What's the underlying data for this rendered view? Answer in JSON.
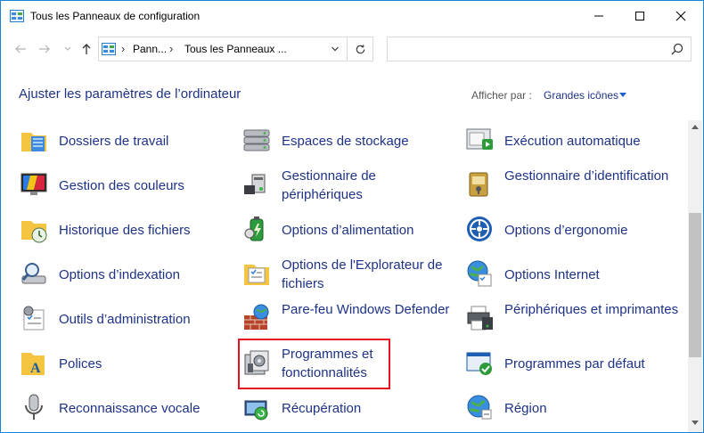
{
  "window": {
    "title": "Tous les Panneaux de configuration",
    "controls": [
      "minimize",
      "maximize",
      "close"
    ]
  },
  "address": {
    "crumb1": "Pann...",
    "crumb2": "Tous les Panneaux ...",
    "search_placeholder": ""
  },
  "header": {
    "title": "Ajuster les paramètres de l’ordinateur",
    "view_label": "Afficher par :",
    "view_value": "Grandes icônes"
  },
  "items": [
    {
      "label": "Dossiers de travail",
      "icon": "work-folders-icon"
    },
    {
      "label": "Espaces de stockage",
      "icon": "storage-spaces-icon"
    },
    {
      "label": "Exécution automatique",
      "icon": "autoplay-icon"
    },
    {
      "label": "Gestion des couleurs",
      "icon": "color-management-icon"
    },
    {
      "label": "Gestionnaire de périphériques",
      "icon": "device-manager-icon"
    },
    {
      "label": "Gestionnaire d’identification",
      "icon": "credential-manager-icon"
    },
    {
      "label": "Historique des fichiers",
      "icon": "file-history-icon"
    },
    {
      "label": "Options d’alimentation",
      "icon": "power-options-icon"
    },
    {
      "label": "Options d’ergonomie",
      "icon": "ease-of-access-icon"
    },
    {
      "label": "Options d’indexation",
      "icon": "indexing-options-icon"
    },
    {
      "label": "Options de l'Explorateur de fichiers",
      "icon": "explorer-options-icon"
    },
    {
      "label": "Options Internet",
      "icon": "internet-options-icon"
    },
    {
      "label": "Outils d’administration",
      "icon": "admin-tools-icon"
    },
    {
      "label": "Pare-feu Windows Defender",
      "icon": "firewall-icon"
    },
    {
      "label": "Périphériques et imprimantes",
      "icon": "devices-printers-icon"
    },
    {
      "label": "Polices",
      "icon": "fonts-icon"
    },
    {
      "label": "Programmes et fonctionnalités",
      "icon": "programs-features-icon",
      "highlighted": true
    },
    {
      "label": "Programmes par défaut",
      "icon": "default-programs-icon"
    },
    {
      "label": "Reconnaissance vocale",
      "icon": "speech-recognition-icon"
    },
    {
      "label": "Récupération",
      "icon": "recovery-icon"
    },
    {
      "label": "Région",
      "icon": "region-icon"
    }
  ],
  "colors": {
    "link": "#1e3287",
    "window_border": "#1883d7",
    "highlight": "#e81123"
  }
}
